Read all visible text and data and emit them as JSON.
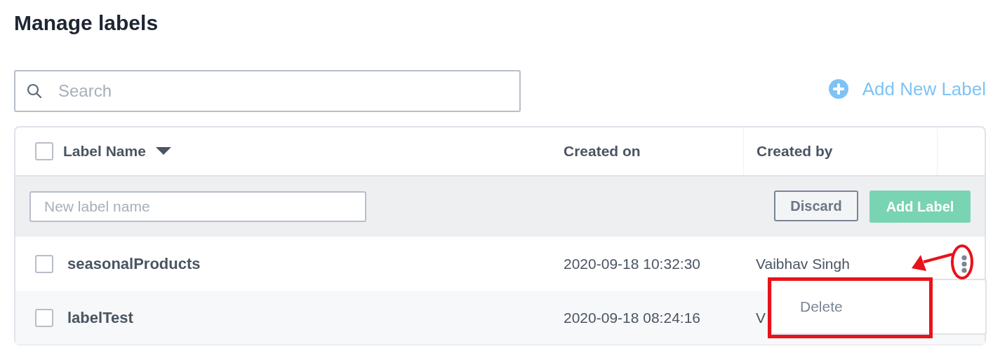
{
  "title": "Manage labels",
  "search": {
    "placeholder": "Search"
  },
  "add_new_label": "Add New Label",
  "table": {
    "select_all": {
      "checked": false
    },
    "columns": [
      {
        "label": "Label Name",
        "sortable": true
      },
      {
        "label": "Created on",
        "sortable": false
      },
      {
        "label": "Created by",
        "sortable": false
      }
    ],
    "new_row": {
      "placeholder": "New label name",
      "discard": "Discard",
      "add": "Add Label"
    },
    "rows": [
      {
        "name": "seasonalProducts",
        "created_on": "2020-09-18 10:32:30",
        "created_by": "Vaibhav Singh",
        "checked": false,
        "menu": true
      },
      {
        "name": "labelTest",
        "created_on": "2020-09-18 08:24:16",
        "created_by": "V",
        "checked": false,
        "menu": false
      }
    ]
  },
  "row_menu": {
    "items": [
      "Delete"
    ]
  }
}
